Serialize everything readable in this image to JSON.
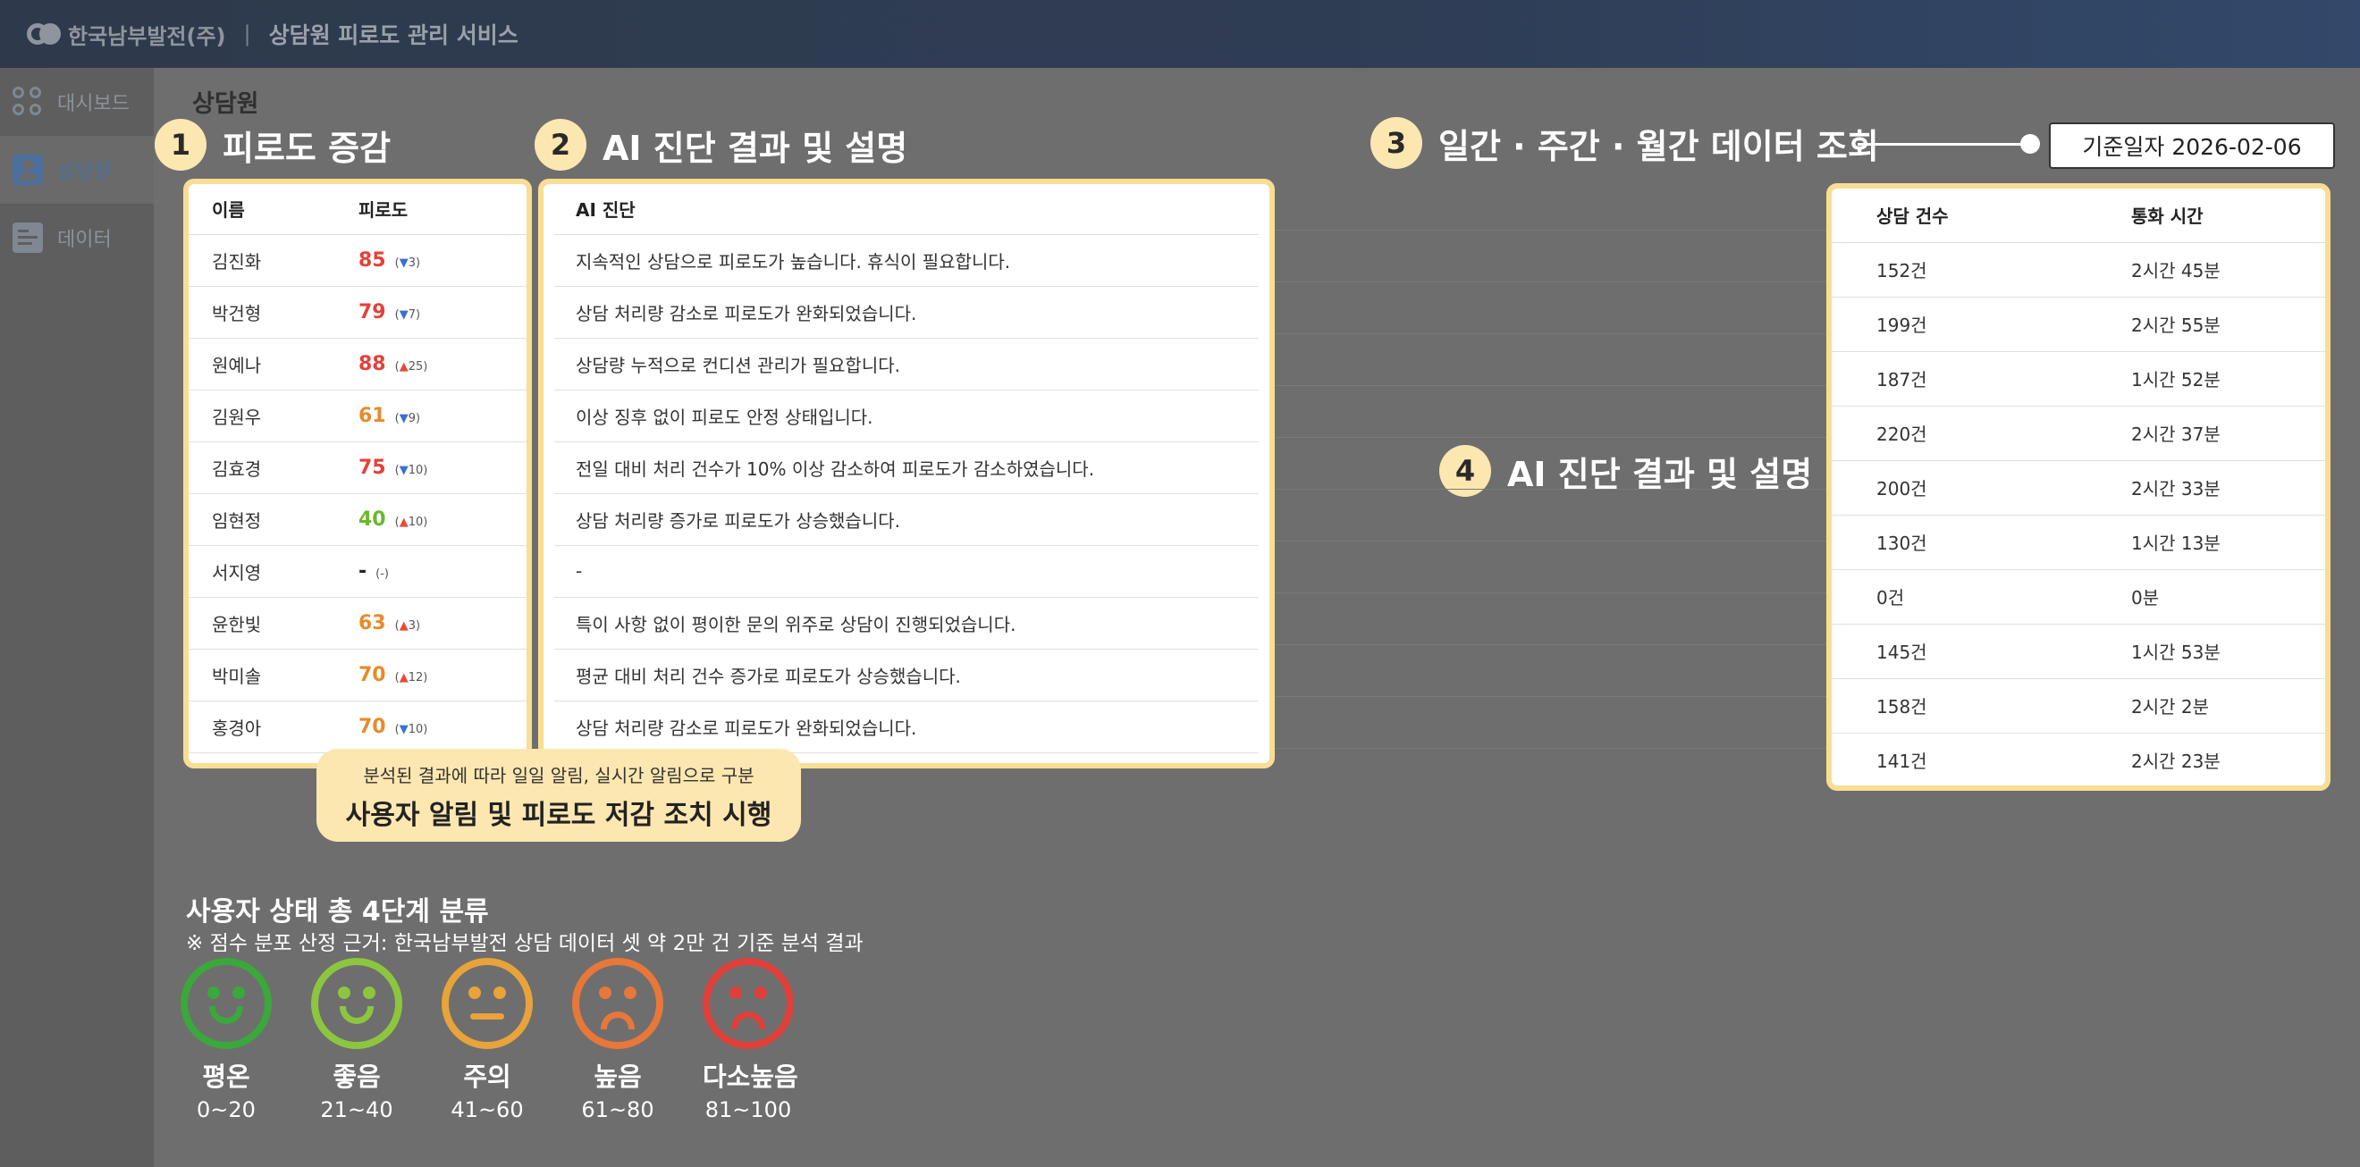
{
  "header": {
    "brand": "한국남부발전(주)",
    "separator": "|",
    "title": "상담원 피로도 관리 서비스"
  },
  "sidebar": {
    "items": [
      {
        "label": "대시보드",
        "icon": "dashboard-icon"
      },
      {
        "label": "상담원",
        "icon": "person-icon",
        "active": true
      },
      {
        "label": "데이터",
        "icon": "data-icon"
      }
    ]
  },
  "breadcrumb": "상담원",
  "sections": {
    "s1": {
      "num": "1",
      "label": "피로도 증감"
    },
    "s2": {
      "num": "2",
      "label": "AI 진단 결과 및 설명"
    },
    "s3": {
      "num": "3",
      "label": "일간 · 주간 · 월간 데이터 조회"
    },
    "s4": {
      "num": "4",
      "label": "AI 진단 결과 및 설명"
    }
  },
  "date_box": "기준일자 2026-02-06",
  "fatigue_table": {
    "headers": [
      "이름",
      "피로도"
    ],
    "rows": [
      {
        "name": "김진화",
        "score": "85",
        "dir": "▼",
        "change": "3",
        "color": "#e5403a"
      },
      {
        "name": "박건형",
        "score": "79",
        "dir": "▼",
        "change": "7",
        "color": "#e5403a"
      },
      {
        "name": "원예나",
        "score": "88",
        "dir": "▲",
        "change": "25",
        "color": "#e5403a"
      },
      {
        "name": "김원우",
        "score": "61",
        "dir": "▼",
        "change": "9",
        "color": "#e88a2a"
      },
      {
        "name": "김효경",
        "score": "75",
        "dir": "▼",
        "change": "10",
        "color": "#e5403a"
      },
      {
        "name": "임현정",
        "score": "40",
        "dir": "▲",
        "change": "10",
        "color": "#6bb82f"
      },
      {
        "name": "서지영",
        "score": "-",
        "dir": "",
        "change": "-",
        "color": "#222222"
      },
      {
        "name": "윤한빛",
        "score": "63",
        "dir": "▲",
        "change": "3",
        "color": "#e88a2a"
      },
      {
        "name": "박미솔",
        "score": "70",
        "dir": "▲",
        "change": "12",
        "color": "#e88a2a"
      },
      {
        "name": "홍경아",
        "score": "70",
        "dir": "▼",
        "change": "10",
        "color": "#e88a2a"
      }
    ]
  },
  "ai_table": {
    "header": "AI 진단",
    "rows": [
      "지속적인 상담으로 피로도가 높습니다. 휴식이 필요합니다.",
      "상담 처리량 감소로 피로도가 완화되었습니다.",
      "상담량 누적으로 컨디션 관리가 필요합니다.",
      "이상 징후 없이 피로도 안정 상태입니다.",
      "전일 대비 처리 건수가 10% 이상 감소하여 피로도가 감소하였습니다.",
      "상담 처리량 증가로 피로도가 상승했습니다.",
      "-",
      "특이 사항 없이 평이한 문의 위주로 상담이 진행되었습니다.",
      "평균 대비 처리 건수 증가로 피로도가 상승했습니다.",
      "상담 처리량 감소로 피로도가 완화되었습니다."
    ]
  },
  "stats_table": {
    "headers": [
      "상담 건수",
      "통화 시간"
    ],
    "rows": [
      [
        "152건",
        "2시간 45분"
      ],
      [
        "199건",
        "2시간 55분"
      ],
      [
        "187건",
        "1시간 52분"
      ],
      [
        "220건",
        "2시간 37분"
      ],
      [
        "200건",
        "2시간 33분"
      ],
      [
        "130건",
        "1시간 13분"
      ],
      [
        "0건",
        "0분"
      ],
      [
        "145건",
        "1시간 53분"
      ],
      [
        "158건",
        "2시간 2분"
      ],
      [
        "141건",
        "2시간 23분"
      ]
    ]
  },
  "tooltip": {
    "small": "분석된 결과에 따라 일일 알림, 실시간 알림으로 구분",
    "big": "사용자 알림 및 피로도 저감 조치 시행"
  },
  "classification": {
    "title": "사용자 상태 총 4단계 분류",
    "note": "※ 점수 분포 산정 근거: 한국남부발전 상담 데이터 셋 약 2만 건 기준 분석 결과",
    "levels": [
      {
        "name": "평온",
        "range": "0~20",
        "color": "#3aa83a",
        "mood": "smile"
      },
      {
        "name": "좋음",
        "range": "21~40",
        "color": "#8cc63f",
        "mood": "smile"
      },
      {
        "name": "주의",
        "range": "41~60",
        "color": "#e8a33a",
        "mood": "flat"
      },
      {
        "name": "높음",
        "range": "61~80",
        "color": "#e8773a",
        "mood": "frown"
      },
      {
        "name": "다소높음",
        "range": "81~100",
        "color": "#e0403a",
        "mood": "frown"
      }
    ]
  }
}
